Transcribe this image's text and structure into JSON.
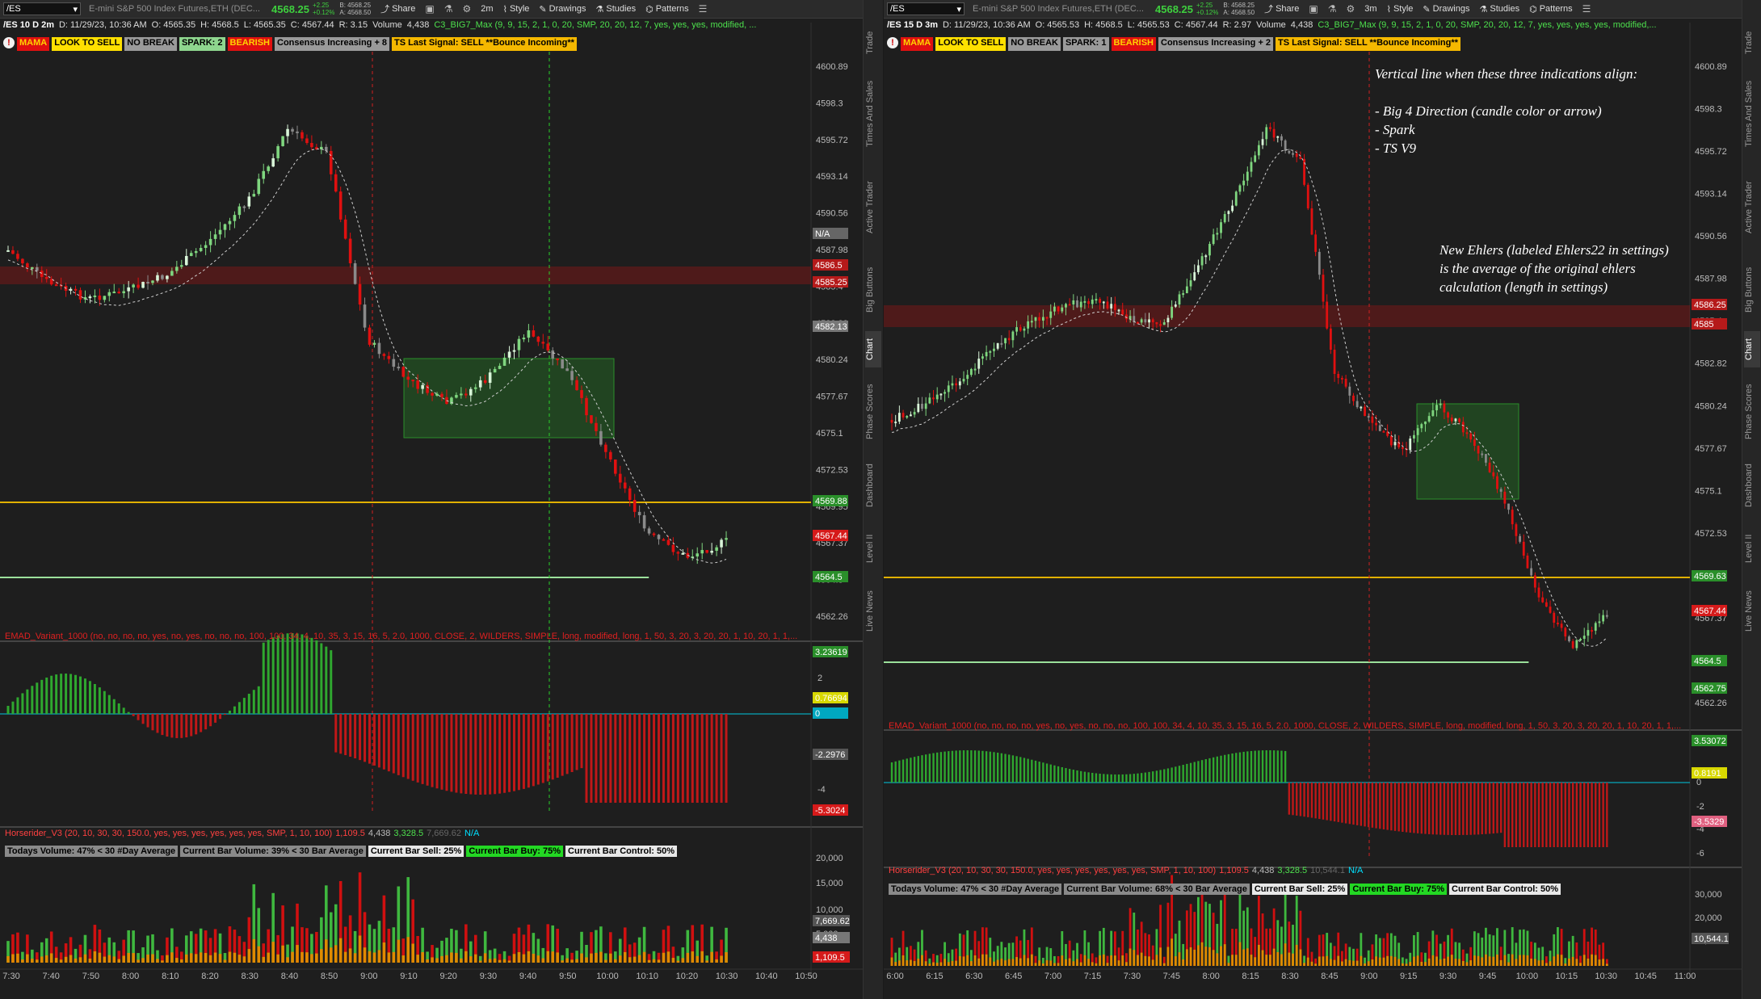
{
  "left": {
    "symbol": "/ES",
    "description": "E-mini S&P 500 Index Futures,ETH (DEC...",
    "last": "4568.25",
    "change": [
      "+2.25",
      "+0.12%"
    ],
    "bid_ask": [
      "B: 4568.25",
      "A: 4568.50"
    ],
    "toolbar": {
      "share": "Share",
      "aggregation": "2m",
      "style": "Style",
      "drawings": "Drawings",
      "studies": "Studies",
      "patterns": "Patterns"
    },
    "info": {
      "tf": "/ES 10 D 2m",
      "date": "D: 11/29/23, 10:36 AM",
      "open": "O: 4565.35",
      "high": "H: 4568.5",
      "low": "L: 4565.35",
      "close": "C: 4567.44",
      "range": "R: 3.15",
      "vol_label": "Volume",
      "vol": "4,438",
      "study": "C3_BIG7_Max (9, 9, 15, 2, 1, 0, 20, SMP, 20, 20, 12, 7, yes, yes, yes, modified, ..."
    },
    "labels": [
      "MAMA",
      "LOOK TO SELL",
      "NO BREAK",
      "SPARK: 2",
      "BEARISH",
      "Consensus Increasing + 8",
      "TS Last Signal: SELL **Bounce Incoming**"
    ],
    "price_ticks": [
      "4600.89",
      "4598.3",
      "4595.72",
      "4593.14",
      "4590.56",
      "4587.98",
      "4585.4",
      "4582.82",
      "4580.24",
      "4577.67",
      "4575.1",
      "4572.53",
      "4569.95",
      "4567.37",
      "4564.8",
      "4562.26"
    ],
    "price_tags": [
      {
        "text": "N/A",
        "bg": "#666666"
      },
      {
        "text": "4586.5",
        "bg": "#b51a1a"
      },
      {
        "text": "4585.25",
        "bg": "#b51a1a"
      },
      {
        "text": "4582.13",
        "bg": "#777777"
      },
      {
        "text": "4569.88",
        "bg": "#2a8f2a"
      },
      {
        "text": "4567.44",
        "bg": "#d61a1a"
      },
      {
        "text": "4564.5",
        "bg": "#2a8f2a"
      }
    ],
    "emad": {
      "title": "EMAD_Variant_1000 (no, no, no, no, yes, no, yes, no, no, no, 100, 100, 34, 4, 10, 35, 3, 15, 16, 5, 2.0, 1000, CLOSE, 2, WILDERS, SIMPLE, long, modified, long, 1, 50, 3, 20, 3, 20, 20, 1, 10, 20, 1, 1,...",
      "ticks": [
        "2",
        "0",
        "-2",
        "-4"
      ],
      "tags": [
        {
          "text": "3.23619",
          "bg": "#2a8f2a"
        },
        {
          "text": "0.76694",
          "bg": "#d8d800"
        },
        {
          "text": "0",
          "bg": "#00a8c0"
        },
        {
          "text": "-2.2976",
          "bg": "#555555"
        },
        {
          "text": "-5.3024",
          "bg": "#d61a1a"
        }
      ]
    },
    "horserider": {
      "title": "Horserider_V3 (20, 10, 30, 30, 150.0, yes, yes, yes, yes, yes, yes, SMP, 1, 10, 100)",
      "v1": "1,109.5",
      "v2": "4,438",
      "v3": "3,328.5",
      "v4": "7,669.62",
      "v5": "N/A"
    },
    "vol_labels": [
      "Todays Volume: 47% < 30 #Day Average",
      "Current Bar Volume: 39% < 30 Bar Average",
      "Current Bar Sell: 25%",
      "Current Bar Buy: 75%",
      "Current Bar Control: 50%"
    ],
    "vol_ticks": [
      "20,000",
      "15,000",
      "10,000",
      "5,000"
    ],
    "vol_tags": [
      {
        "text": "7,669.62",
        "bg": "#555555"
      },
      {
        "text": "4,438",
        "bg": "#777777"
      },
      {
        "text": "1,109.5",
        "bg": "#d61a1a"
      }
    ],
    "time_ticks": [
      "7:30",
      "7:40",
      "7:50",
      "8:00",
      "8:10",
      "8:20",
      "8:30",
      "8:40",
      "8:50",
      "9:00",
      "9:10",
      "9:20",
      "9:30",
      "9:40",
      "9:50",
      "10:00",
      "10:10",
      "10:20",
      "10:30",
      "10:40",
      "10:50"
    ],
    "side_tabs": [
      "Trade",
      "Times And Sales",
      "Active Trader",
      "Big Buttons",
      "Chart",
      "Phase Scores",
      "Dashboard",
      "Level II",
      "Live News"
    ]
  },
  "right": {
    "symbol": "/ES",
    "description": "E-mini S&P 500 Index Futures,ETH (DEC...",
    "last": "4568.25",
    "change": [
      "+2.25",
      "+0.12%"
    ],
    "bid_ask": [
      "B: 4568.25",
      "A: 4568.50"
    ],
    "toolbar": {
      "share": "Share",
      "aggregation": "3m",
      "style": "Style",
      "drawings": "Drawings",
      "studies": "Studies",
      "patterns": "Patterns"
    },
    "info": {
      "tf": "/ES 15 D 3m",
      "date": "D: 11/29/23, 10:36 AM",
      "open": "O: 4565.53",
      "high": "H: 4568.5",
      "low": "L: 4565.53",
      "close": "C: 4567.44",
      "range": "R: 2.97",
      "vol_label": "Volume",
      "vol": "4,438",
      "study": "C3_BIG7_Max (9, 9, 15, 2, 1, 0, 20, SMP, 20, 20, 12, 7, yes, yes, yes, yes, modified,..."
    },
    "labels": [
      "MAMA",
      "LOOK TO SELL",
      "NO BREAK",
      "SPARK: 1",
      "BEARISH",
      "Consensus Increasing + 2",
      "TS Last Signal: SELL **Bounce Incoming**"
    ],
    "price_ticks": [
      "4600.89",
      "4598.3",
      "4595.72",
      "4593.14",
      "4590.56",
      "4587.98",
      "4585.4",
      "4582.82",
      "4580.24",
      "4577.67",
      "4575.1",
      "4572.53",
      "4569.95",
      "4567.37",
      "4564.8",
      "4562.26"
    ],
    "price_tags": [
      {
        "text": "4586.25",
        "bg": "#b51a1a"
      },
      {
        "text": "4585",
        "bg": "#b51a1a"
      },
      {
        "text": "4569.63",
        "bg": "#2a8f2a"
      },
      {
        "text": "4567.44",
        "bg": "#d61a1a"
      },
      {
        "text": "4564.5",
        "bg": "#2a8f2a"
      },
      {
        "text": "4562.75",
        "bg": "#2a8f2a"
      }
    ],
    "emad": {
      "title": "EMAD_Variant_1000 (no, no, no, no, yes, no, yes, no, no, no, 100, 100, 34, 4, 10, 35, 3, 15, 16, 5, 2.0, 1000, CLOSE, 2, WILDERS, SIMPLE, long, modified, long, 1, 50, 3, 20, 3, 20, 20, 1, 10, 20, 1, 1,...",
      "ticks": [
        "2",
        "0",
        "-2",
        "-4",
        "-6"
      ],
      "tags": [
        {
          "text": "3.53072",
          "bg": "#2a8f2a"
        },
        {
          "text": "0.8191",
          "bg": "#d8d800"
        },
        {
          "text": "-3.5329",
          "bg": "#e06080"
        }
      ]
    },
    "horserider": {
      "title": "Horserider_V3 (20, 10, 30, 30, 150.0, yes, yes, yes, yes, yes, yes, SMP, 1, 10, 100)",
      "v1": "1,109.5",
      "v2": "4,438",
      "v3": "3,328.5",
      "v4": "10,544.1",
      "v5": "N/A"
    },
    "vol_labels": [
      "Todays Volume: 47% < 30 #Day Average",
      "Current Bar Volume: 68% < 30 Bar Average",
      "Current Bar Sell: 25%",
      "Current Bar Buy: 75%",
      "Current Bar Control: 50%"
    ],
    "vol_ticks": [
      "30,000",
      "20,000",
      "10,000"
    ],
    "vol_tags": [
      {
        "text": "10,544.1",
        "bg": "#555555"
      }
    ],
    "time_ticks": [
      "6:00",
      "6:15",
      "6:30",
      "6:45",
      "7:00",
      "7:15",
      "7:30",
      "7:45",
      "8:00",
      "8:15",
      "8:30",
      "8:45",
      "9:00",
      "9:15",
      "9:30",
      "9:45",
      "10:00",
      "10:15",
      "10:30",
      "10:45",
      "11:00"
    ],
    "annotation_1": "Vertical line when these three indications align:\n\n- Big 4 Direction (candle color or arrow)\n- Spark\n- TS V9",
    "annotation_2": "New Ehlers (labeled Ehlers22 in settings)\nis the average of the original ehlers\ncalculation (length in settings)",
    "side_tabs": [
      "Trade",
      "Times And Sales",
      "Active Trader",
      "Big Buttons",
      "Chart",
      "Phase Scores",
      "Dashboard",
      "Level II",
      "Live News"
    ]
  }
}
